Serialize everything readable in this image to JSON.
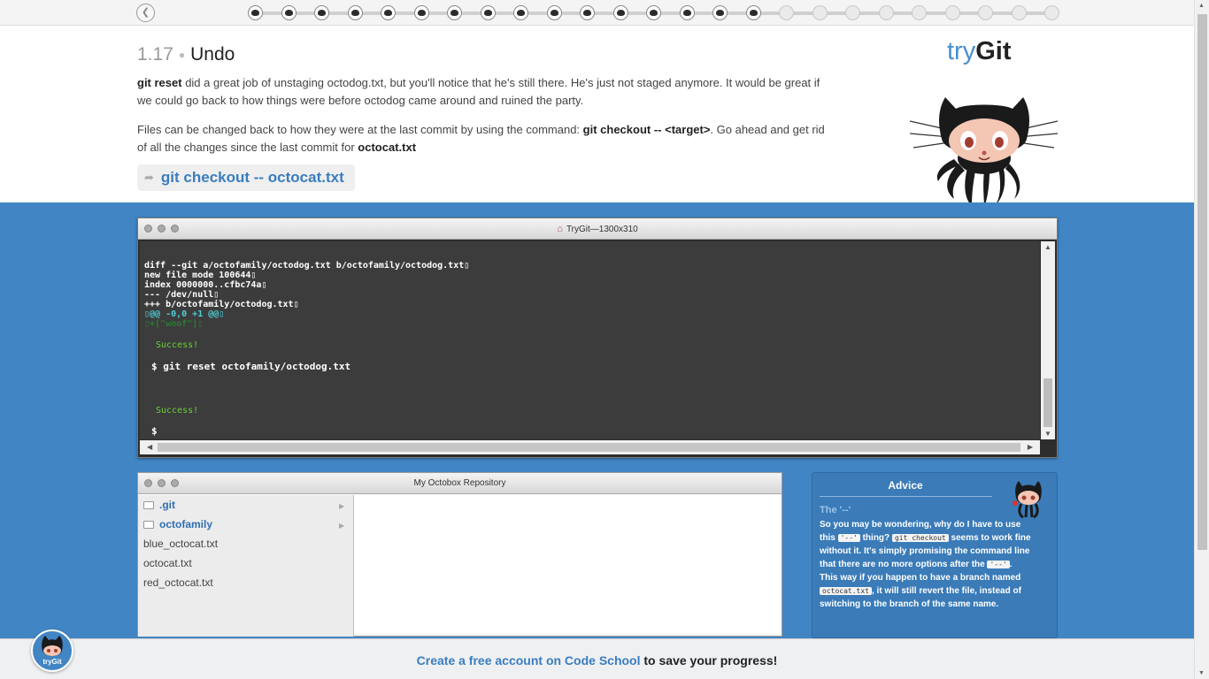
{
  "topbar": {
    "back_icon": "chevron-left-circle-icon",
    "progress": {
      "completed_steps": 16,
      "total_steps": 25
    }
  },
  "lesson": {
    "number": "1.17",
    "title": "Undo",
    "para1": {
      "cmd": "git reset",
      "text": " did a great job of unstaging octodog.txt, but you'll notice that he's still there. He's just not staged anymore. It would be great if we could go back to how things were before octodog came around and ruined the party."
    },
    "para2": {
      "text_a": "Files can be changed back to how they were at the last commit by using the command: ",
      "cmd": "git checkout -- <target>",
      "text_b": ". Go ahead and get rid of all the changes since the last commit for ",
      "file": "octocat.txt"
    },
    "command": "git checkout -- octocat.txt",
    "command_icon": "arrow-right-icon"
  },
  "logo": {
    "try": "try",
    "git": "Git"
  },
  "terminal": {
    "title": "TryGit—1300x310",
    "title_icon": "home-icon",
    "diff_lines": [
      {
        "text": "diff --git a/octofamily/octodog.txt b/octofamily/octodog.txt▯",
        "color": "white"
      },
      {
        "text": "new file mode 100644▯",
        "color": "white"
      },
      {
        "text": "index 0000000..cfbc74a▯",
        "color": "white"
      },
      {
        "text": "--- /dev/null▯",
        "color": "white"
      },
      {
        "text": "+++ b/octofamily/octodog.txt▯",
        "color": "white"
      },
      {
        "text": "▯@@ -0,0 +1 @@▯",
        "color": "cyan"
      },
      {
        "text": "▯+[\"woof\"]▯",
        "color": "dimgreen"
      }
    ],
    "success1": "Success!",
    "prompt1": "$ git reset octofamily/octodog.txt",
    "success2": "Success!",
    "prompt2": "$"
  },
  "repo": {
    "title": "My Octobox Repository",
    "items": [
      {
        "name": ".git",
        "type": "folder"
      },
      {
        "name": "octofamily",
        "type": "folder"
      },
      {
        "name": "blue_octocat.txt",
        "type": "file"
      },
      {
        "name": "octocat.txt",
        "type": "file"
      },
      {
        "name": "red_octocat.txt",
        "type": "file"
      }
    ]
  },
  "advice": {
    "title": "Advice",
    "subtitle": "The '--'",
    "body": {
      "t1": "So you may be wondering, why do I have to use this ",
      "c1": "'--'",
      "t2": " thing? ",
      "c2": "git checkout",
      "t3": " seems to work fine without it. It's simply promising the command line that there are no more options after the ",
      "c3": "'--'",
      "t4": ". This way if you happen to have a branch named ",
      "c4": "octocat.txt",
      "t5": ", it will still revert the file, instead of switching to the branch of the same name."
    }
  },
  "bottom": {
    "link": "Create a free account on Code School",
    "text": " to save your progress!",
    "badge": "tryGit"
  },
  "colors": {
    "accent": "#3a7dbe",
    "blue_bg": "#4185c4",
    "terminal_bg": "#3c3c3c",
    "success": "#6cd13a"
  }
}
